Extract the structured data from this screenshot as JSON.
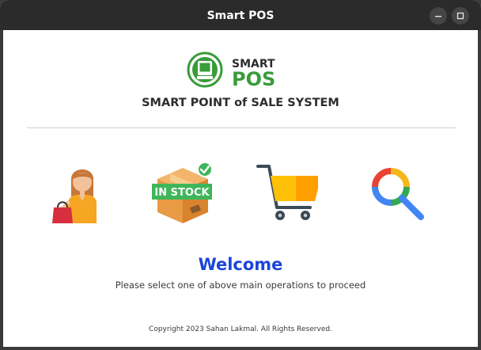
{
  "window": {
    "title": "Smart POS",
    "controls": {
      "minimize_icon": "minimize-icon",
      "maximize_icon": "maximize-icon",
      "close_icon": "close-icon"
    }
  },
  "logo": {
    "line1": "SMART",
    "line2": "POS",
    "icon": "pos-terminal-icon",
    "color": "#3a9b3a"
  },
  "header": {
    "subtitle": "SMART POINT of SALE SYSTEM"
  },
  "operations": [
    {
      "icon": "shopper-icon"
    },
    {
      "icon": "in-stock-box-icon",
      "label": "IN STOCK"
    },
    {
      "icon": "shopping-cart-icon"
    },
    {
      "icon": "search-icon"
    }
  ],
  "main": {
    "welcome": "Welcome",
    "instruction": "Please select one of above main operations to proceed",
    "welcome_color": "#1c46d8"
  },
  "footer": {
    "copyright": "Copyright 2023 Sahan Lakmal. All Rights Reserved."
  }
}
